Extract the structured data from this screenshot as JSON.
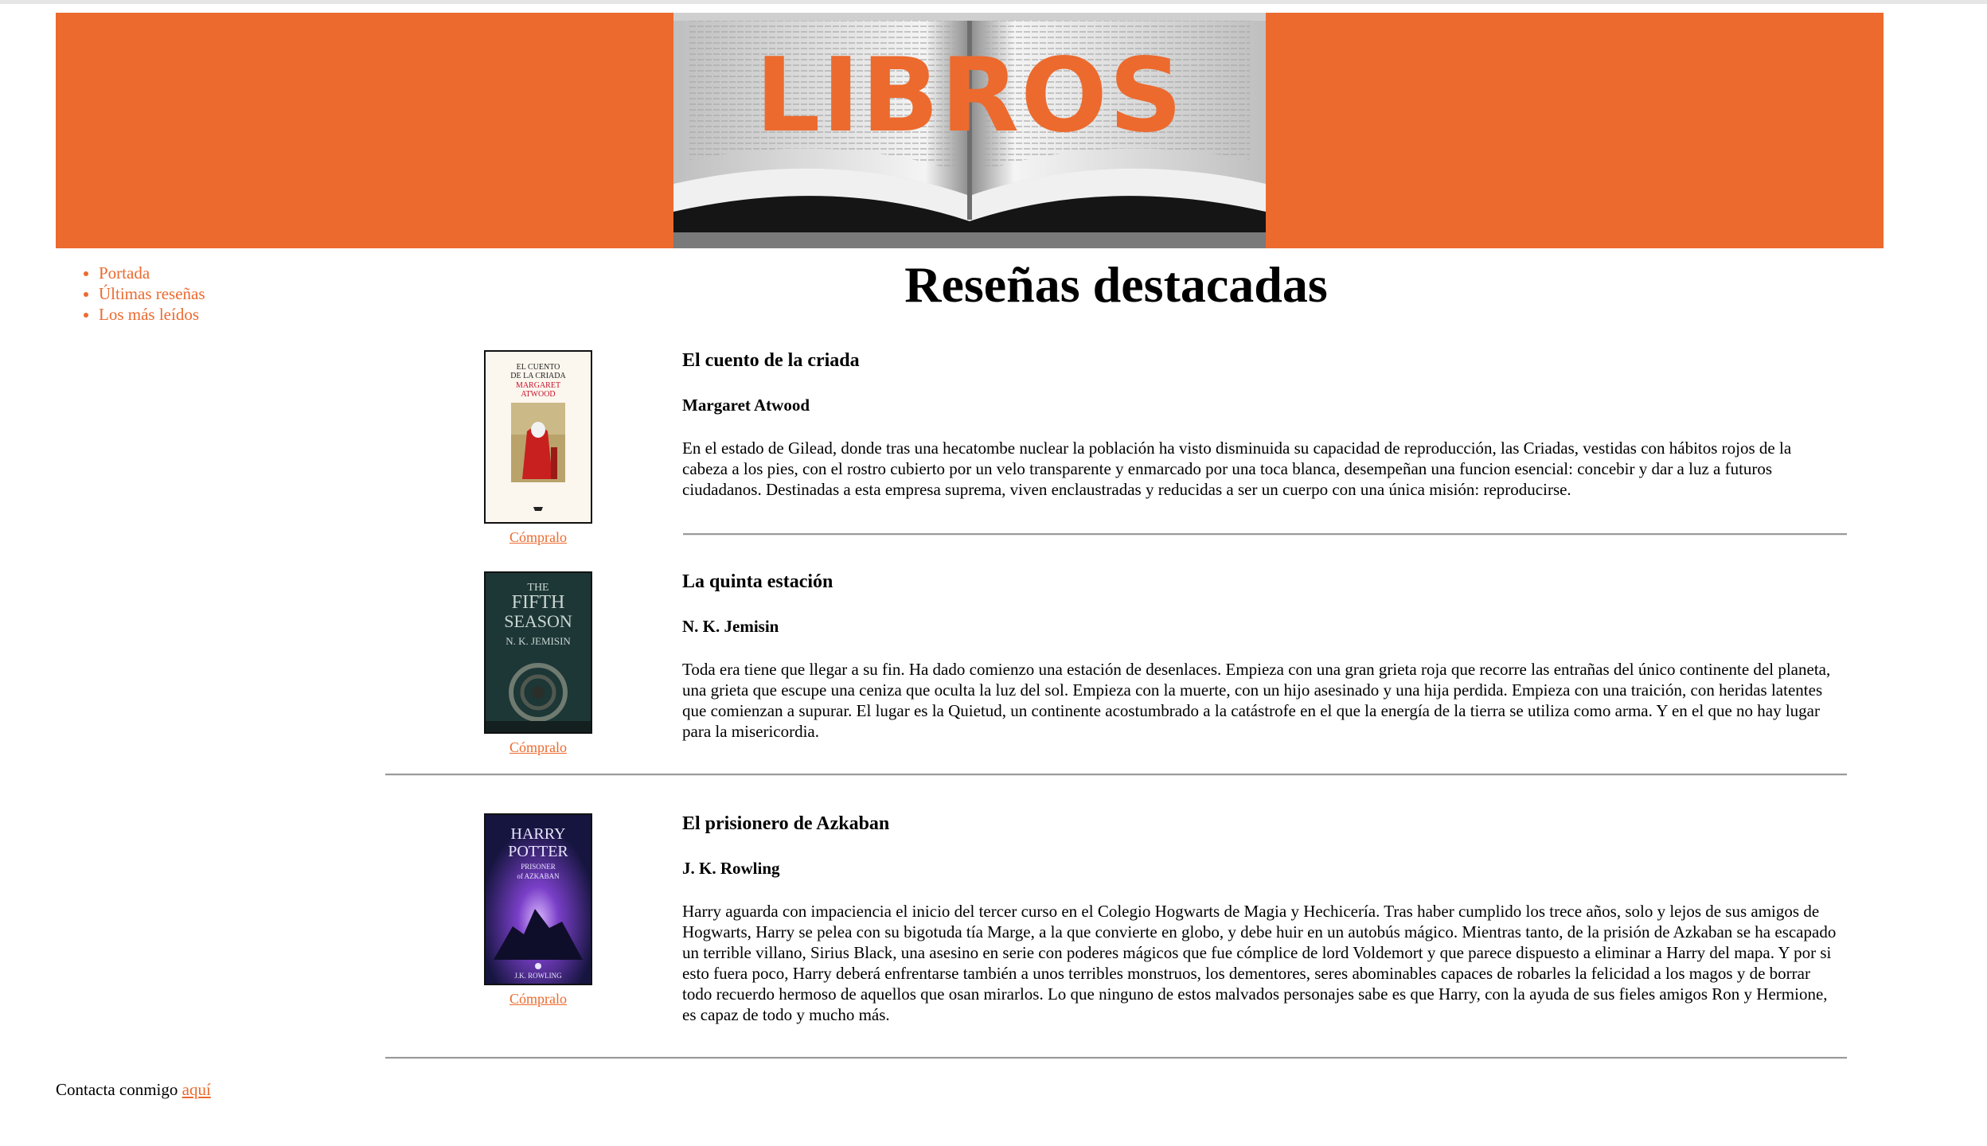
{
  "header": {
    "banner_title": "LIBROS"
  },
  "nav": {
    "items": [
      {
        "label": "Portada"
      },
      {
        "label": "Últimas reseñas"
      },
      {
        "label": "Los más leídos"
      }
    ]
  },
  "main": {
    "title": "Reseñas destacadas",
    "reviews": [
      {
        "title": "El cuento de la criada",
        "author": "Margaret Atwood",
        "summary": "En el estado de Gilead, donde tras una hecatombe nuclear la población ha visto disminuida su capacidad de reproducción, las Criadas, vestidas con hábitos rojos de la cabeza a los pies, con el rostro cubierto por un velo transparente y enmarcado por una toca blanca, desempeñan una funcion esencial: concebir y dar a luz a futuros ciudadanos. Destinadas a esta empresa suprema, viven enclaustradas y reducidas a ser un cuerpo con una única misión: reproducirse.",
        "buy_label": "Cómpralo",
        "cover_text": [
          "EL CUENTO",
          "DE LA CRIADA",
          "MARGARET",
          "ATWOOD"
        ]
      },
      {
        "title": "La quinta estación",
        "author": "N. K. Jemisin",
        "summary": "Toda era tiene que llegar a su fin. Ha dado comienzo una estación de desenlaces. Empieza con una gran grieta roja que recorre las entrañas del único continente del planeta, una grieta que escupe una ceniza que oculta la luz del sol. Empieza con la muerte, con un hijo asesinado y una hija perdida. Empieza con una traición, con heridas latentes que comienzan a supurar. El lugar es la Quietud, un continente acostumbrado a la catástrofe en el que la energía de la tierra se utiliza como arma. Y en el que no hay lugar para la misericordia.",
        "buy_label": "Cómpralo",
        "cover_text": [
          "THE",
          "FIFTH",
          "SEASON",
          "N. K. JEMISIN"
        ]
      },
      {
        "title": "El prisionero de Azkaban",
        "author": "J. K. Rowling",
        "summary": "Harry aguarda con impaciencia el inicio del tercer curso en el Colegio Hogwarts de Magia y Hechicería. Tras haber cumplido los trece años, solo y lejos de sus amigos de Hogwarts, Harry se pelea con su bigotuda tía Marge, a la que convierte en globo, y debe huir en un autobús mágico. Mientras tanto, de la prisión de Azkaban se ha escapado un terrible villano, Sirius Black, una asesino en serie con poderes mágicos que fue cómplice de lord Voldemort y que parece dispuesto a eliminar a Harry del mapa. Y por si esto fuera poco, Harry deberá enfrentarse también a unos terribles monstruos, los dementores, seres abominables capaces de robarles la felicidad a los magos y de borrar todo recuerdo hermoso de aquellos que osan mirarlos. Lo que ninguno de estos malvados personajes sabe es que Harry, con la ayuda de sus fieles amigos Ron y Hermione, es capaz de todo y mucho más.",
        "buy_label": "Cómpralo",
        "cover_text": [
          "HARRY",
          "POTTER",
          "PRISONER",
          "of AZKABAN",
          "J.K. ROWLING"
        ]
      }
    ]
  },
  "footer": {
    "text": "Contacta conmigo",
    "link_label": "aquí"
  },
  "colors": {
    "accent": "#ec6a2e",
    "divider": "#9a9a9a"
  }
}
